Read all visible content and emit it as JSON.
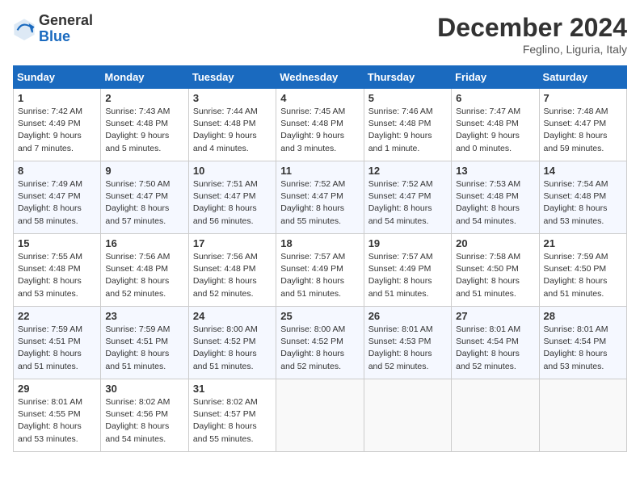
{
  "logo": {
    "general": "General",
    "blue": "Blue"
  },
  "title": "December 2024",
  "subtitle": "Feglino, Liguria, Italy",
  "days_header": [
    "Sunday",
    "Monday",
    "Tuesday",
    "Wednesday",
    "Thursday",
    "Friday",
    "Saturday"
  ],
  "weeks": [
    [
      {
        "day": "1",
        "info": "Sunrise: 7:42 AM\nSunset: 4:49 PM\nDaylight: 9 hours\nand 7 minutes."
      },
      {
        "day": "2",
        "info": "Sunrise: 7:43 AM\nSunset: 4:48 PM\nDaylight: 9 hours\nand 5 minutes."
      },
      {
        "day": "3",
        "info": "Sunrise: 7:44 AM\nSunset: 4:48 PM\nDaylight: 9 hours\nand 4 minutes."
      },
      {
        "day": "4",
        "info": "Sunrise: 7:45 AM\nSunset: 4:48 PM\nDaylight: 9 hours\nand 3 minutes."
      },
      {
        "day": "5",
        "info": "Sunrise: 7:46 AM\nSunset: 4:48 PM\nDaylight: 9 hours\nand 1 minute."
      },
      {
        "day": "6",
        "info": "Sunrise: 7:47 AM\nSunset: 4:48 PM\nDaylight: 9 hours\nand 0 minutes."
      },
      {
        "day": "7",
        "info": "Sunrise: 7:48 AM\nSunset: 4:47 PM\nDaylight: 8 hours\nand 59 minutes."
      }
    ],
    [
      {
        "day": "8",
        "info": "Sunrise: 7:49 AM\nSunset: 4:47 PM\nDaylight: 8 hours\nand 58 minutes."
      },
      {
        "day": "9",
        "info": "Sunrise: 7:50 AM\nSunset: 4:47 PM\nDaylight: 8 hours\nand 57 minutes."
      },
      {
        "day": "10",
        "info": "Sunrise: 7:51 AM\nSunset: 4:47 PM\nDaylight: 8 hours\nand 56 minutes."
      },
      {
        "day": "11",
        "info": "Sunrise: 7:52 AM\nSunset: 4:47 PM\nDaylight: 8 hours\nand 55 minutes."
      },
      {
        "day": "12",
        "info": "Sunrise: 7:52 AM\nSunset: 4:47 PM\nDaylight: 8 hours\nand 54 minutes."
      },
      {
        "day": "13",
        "info": "Sunrise: 7:53 AM\nSunset: 4:48 PM\nDaylight: 8 hours\nand 54 minutes."
      },
      {
        "day": "14",
        "info": "Sunrise: 7:54 AM\nSunset: 4:48 PM\nDaylight: 8 hours\nand 53 minutes."
      }
    ],
    [
      {
        "day": "15",
        "info": "Sunrise: 7:55 AM\nSunset: 4:48 PM\nDaylight: 8 hours\nand 53 minutes."
      },
      {
        "day": "16",
        "info": "Sunrise: 7:56 AM\nSunset: 4:48 PM\nDaylight: 8 hours\nand 52 minutes."
      },
      {
        "day": "17",
        "info": "Sunrise: 7:56 AM\nSunset: 4:48 PM\nDaylight: 8 hours\nand 52 minutes."
      },
      {
        "day": "18",
        "info": "Sunrise: 7:57 AM\nSunset: 4:49 PM\nDaylight: 8 hours\nand 51 minutes."
      },
      {
        "day": "19",
        "info": "Sunrise: 7:57 AM\nSunset: 4:49 PM\nDaylight: 8 hours\nand 51 minutes."
      },
      {
        "day": "20",
        "info": "Sunrise: 7:58 AM\nSunset: 4:50 PM\nDaylight: 8 hours\nand 51 minutes."
      },
      {
        "day": "21",
        "info": "Sunrise: 7:59 AM\nSunset: 4:50 PM\nDaylight: 8 hours\nand 51 minutes."
      }
    ],
    [
      {
        "day": "22",
        "info": "Sunrise: 7:59 AM\nSunset: 4:51 PM\nDaylight: 8 hours\nand 51 minutes."
      },
      {
        "day": "23",
        "info": "Sunrise: 7:59 AM\nSunset: 4:51 PM\nDaylight: 8 hours\nand 51 minutes."
      },
      {
        "day": "24",
        "info": "Sunrise: 8:00 AM\nSunset: 4:52 PM\nDaylight: 8 hours\nand 51 minutes."
      },
      {
        "day": "25",
        "info": "Sunrise: 8:00 AM\nSunset: 4:52 PM\nDaylight: 8 hours\nand 52 minutes."
      },
      {
        "day": "26",
        "info": "Sunrise: 8:01 AM\nSunset: 4:53 PM\nDaylight: 8 hours\nand 52 minutes."
      },
      {
        "day": "27",
        "info": "Sunrise: 8:01 AM\nSunset: 4:54 PM\nDaylight: 8 hours\nand 52 minutes."
      },
      {
        "day": "28",
        "info": "Sunrise: 8:01 AM\nSunset: 4:54 PM\nDaylight: 8 hours\nand 53 minutes."
      }
    ],
    [
      {
        "day": "29",
        "info": "Sunrise: 8:01 AM\nSunset: 4:55 PM\nDaylight: 8 hours\nand 53 minutes."
      },
      {
        "day": "30",
        "info": "Sunrise: 8:02 AM\nSunset: 4:56 PM\nDaylight: 8 hours\nand 54 minutes."
      },
      {
        "day": "31",
        "info": "Sunrise: 8:02 AM\nSunset: 4:57 PM\nDaylight: 8 hours\nand 55 minutes."
      },
      {
        "day": "",
        "info": ""
      },
      {
        "day": "",
        "info": ""
      },
      {
        "day": "",
        "info": ""
      },
      {
        "day": "",
        "info": ""
      }
    ]
  ]
}
